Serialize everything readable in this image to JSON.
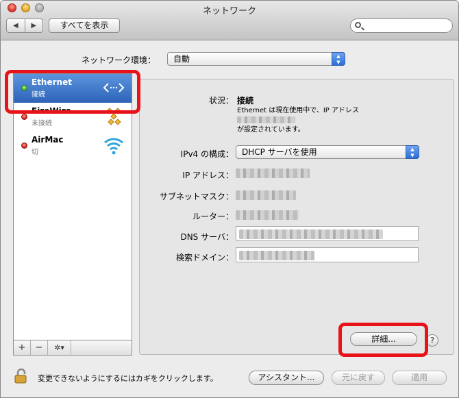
{
  "window": {
    "title": "ネットワーク"
  },
  "toolbar": {
    "back_label": "◀",
    "forward_label": "▶",
    "show_all_label": "すべてを表示",
    "search_placeholder": ""
  },
  "location": {
    "label": "ネットワーク環境：",
    "value": "自動"
  },
  "services": [
    {
      "name": "Ethernet",
      "status": "接続",
      "status_color": "green",
      "icon": "ethernet-icon",
      "selected": true
    },
    {
      "name": "FireWire",
      "status": "未接続",
      "status_color": "red",
      "icon": "firewire-icon",
      "selected": false
    },
    {
      "name": "AirMac",
      "status": "切",
      "status_color": "red",
      "icon": "wifi-icon",
      "selected": false
    }
  ],
  "sidebar_controls": {
    "add": "+",
    "remove": "−",
    "gear": "✲▾"
  },
  "detail": {
    "status_label": "状況：",
    "status_value": "接続",
    "status_desc_1": "Ethernet は現在使用中で、IP アドレス",
    "status_desc_2": "が設定されています。",
    "ipv4_label": "IPv4 の構成：",
    "ipv4_value": "DHCP サーバを使用",
    "ip_label": "IP アドレス：",
    "subnet_label": "サブネットマスク：",
    "router_label": "ルーター：",
    "dns_label": "DNS サーバ：",
    "search_domain_label": "検索ドメイン：",
    "advanced_label": "詳細...",
    "help_label": "?"
  },
  "footer": {
    "lock_text": "変更できないようにするにはカギをクリックします。",
    "assist_label": "アシスタント...",
    "revert_label": "元に戻す",
    "apply_label": "適用"
  },
  "colors": {
    "selection": "#3a74c9",
    "highlight_box": "#e8121a"
  }
}
